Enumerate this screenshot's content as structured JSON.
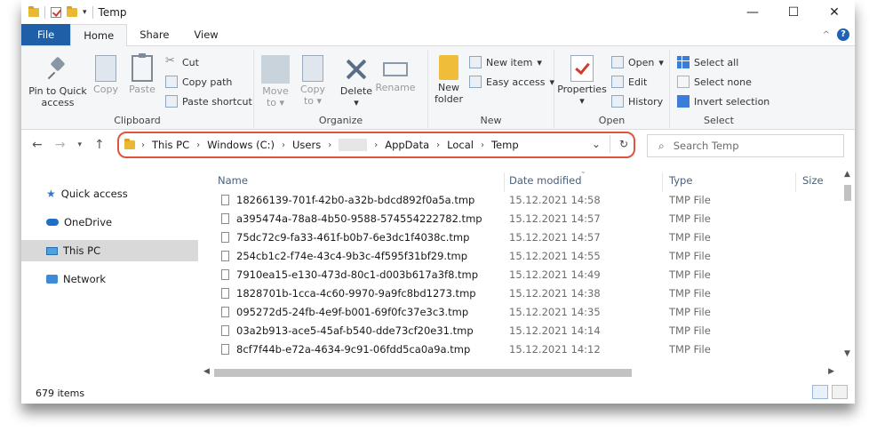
{
  "window": {
    "title": "Temp",
    "controls": {
      "minimize": "—",
      "maximize": "☐",
      "close": "✕"
    }
  },
  "tabs": [
    {
      "label": "File"
    },
    {
      "label": "Home"
    },
    {
      "label": "Share"
    },
    {
      "label": "View"
    }
  ],
  "ribbon": {
    "clipboard": {
      "label": "Clipboard",
      "pin_line1": "Pin to Quick",
      "pin_line2": "access",
      "copy": "Copy",
      "paste": "Paste",
      "cut": "Cut",
      "copy_path": "Copy path",
      "paste_shortcut": "Paste shortcut"
    },
    "organize": {
      "label": "Organize",
      "move_to_line1": "Move",
      "move_to_line2": "to",
      "copy_to_line1": "Copy",
      "copy_to_line2": "to",
      "delete": "Delete",
      "rename": "Rename"
    },
    "new": {
      "label": "New",
      "new_folder_line1": "New",
      "new_folder_line2": "folder",
      "new_item": "New item",
      "easy_access": "Easy access"
    },
    "open": {
      "label": "Open",
      "properties": "Properties",
      "open": "Open",
      "edit": "Edit",
      "history": "History"
    },
    "select": {
      "label": "Select",
      "select_all": "Select all",
      "select_none": "Select none",
      "invert_selection": "Invert selection"
    }
  },
  "address": {
    "crumbs": [
      "This PC",
      "Windows (C:)",
      "Users",
      "AppData",
      "Local",
      "Temp"
    ],
    "search_placeholder": "Search Temp"
  },
  "nav_pane": [
    {
      "label": "Quick access",
      "icon": "star-icon"
    },
    {
      "label": "OneDrive",
      "icon": "cloud-icon"
    },
    {
      "label": "This PC",
      "icon": "computer-icon",
      "selected": true
    },
    {
      "label": "Network",
      "icon": "network-icon"
    }
  ],
  "columns": {
    "name": "Name",
    "date": "Date modified",
    "type": "Type",
    "size": "Size"
  },
  "files": [
    {
      "name": "18266139-701f-42b0-a32b-bdcd892f0a5a.tmp",
      "date": "15.12.2021 14:58",
      "type": "TMP File"
    },
    {
      "name": "a395474a-78a8-4b50-9588-574554222782.tmp",
      "date": "15.12.2021 14:57",
      "type": "TMP File"
    },
    {
      "name": "75dc72c9-fa33-461f-b0b7-6e3dc1f4038c.tmp",
      "date": "15.12.2021 14:57",
      "type": "TMP File"
    },
    {
      "name": "254cb1c2-f74e-43c4-9b3c-4f595f31bf29.tmp",
      "date": "15.12.2021 14:55",
      "type": "TMP File"
    },
    {
      "name": "7910ea15-e130-473d-80c1-d003b617a3f8.tmp",
      "date": "15.12.2021 14:49",
      "type": "TMP File"
    },
    {
      "name": "1828701b-1cca-4c60-9970-9a9fc8bd1273.tmp",
      "date": "15.12.2021 14:38",
      "type": "TMP File"
    },
    {
      "name": "095272d5-24fb-4e9f-b001-69f0fc37e3c3.tmp",
      "date": "15.12.2021 14:35",
      "type": "TMP File"
    },
    {
      "name": "03a2b913-ace5-45af-b540-dde73cf20e31.tmp",
      "date": "15.12.2021 14:14",
      "type": "TMP File"
    },
    {
      "name": "8cf7f44b-e72a-4634-9c91-06fdd5ca0a9a.tmp",
      "date": "15.12.2021 14:12",
      "type": "TMP File"
    }
  ],
  "status": {
    "item_count": "679 items"
  }
}
